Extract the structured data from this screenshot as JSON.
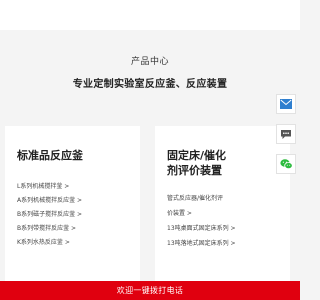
{
  "header": {
    "subtitle": "产品中心",
    "title": "专业定制实验室反应釜、反应装置"
  },
  "cards": [
    {
      "title": "标准品反应釜",
      "items": [
        "L系列机械搅拌釜 >",
        "A系列机械搅拌反应釜 >",
        "B系列磁子搅拌反应釜 >",
        "B系列带搅拌反应釜 >",
        "K系列水热反应釜 >"
      ]
    },
    {
      "title": "固定床/催化剂评价装置",
      "items": [
        "管式反应器/催化剂评",
        "价装置 >",
        "13吨桌面式固定床系列 >",
        "13吨落地式固定床系列 >"
      ]
    }
  ],
  "side_tools": [
    {
      "icon": "mail-icon",
      "color": "#2f7fcf"
    },
    {
      "icon": "message-icon",
      "color": "#555555"
    },
    {
      "icon": "wechat-icon",
      "color": "#2dbb3f"
    }
  ],
  "bottom_bar": {
    "label": "欢迎一键拨打电话",
    "color": "#e0000f"
  }
}
